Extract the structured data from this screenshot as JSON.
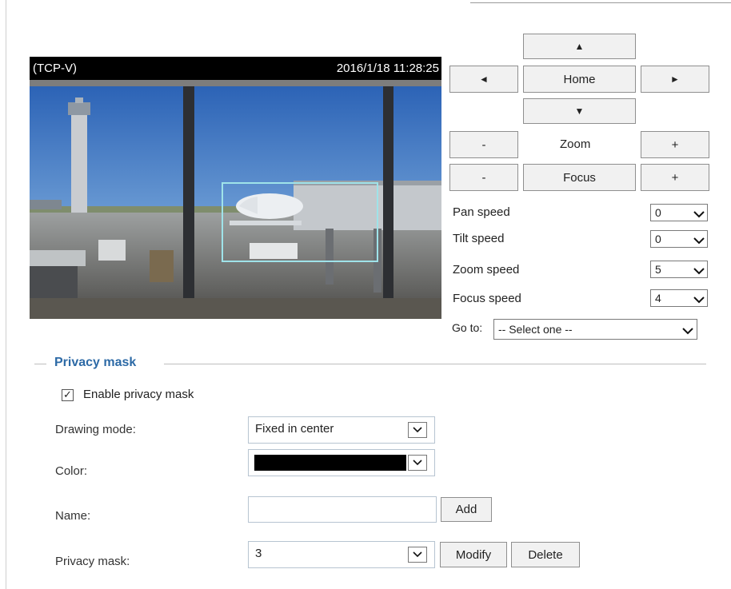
{
  "video": {
    "camera_label": "(TCP-V)",
    "timestamp": "2016/1/18 11:28:25"
  },
  "ptz": {
    "up_glyph": "▲",
    "down_glyph": "▼",
    "left_glyph": "◄",
    "right_glyph": "►",
    "home_label": "Home",
    "zoom_label": "Zoom",
    "focus_label": "Focus",
    "minus_label": "-",
    "plus_label": "+",
    "speeds": [
      {
        "label": "Pan speed",
        "value": "0"
      },
      {
        "label": "Tilt speed",
        "value": "0"
      },
      {
        "label": "Zoom speed",
        "value": "5"
      },
      {
        "label": "Focus speed",
        "value": "4"
      }
    ],
    "goto_label": "Go to:",
    "goto_value": "-- Select one --"
  },
  "privacy": {
    "section_title": "Privacy mask",
    "enable_label": "Enable privacy mask",
    "enable_checked": true,
    "drawing_mode_label": "Drawing mode:",
    "drawing_mode_value": "Fixed in center",
    "color_label": "Color:",
    "color_value": "#000000",
    "name_label": "Name:",
    "name_value": "",
    "add_label": "Add",
    "mask_label": "Privacy mask:",
    "mask_value": "3",
    "modify_label": "Modify",
    "delete_label": "Delete"
  },
  "icons": {
    "check": "✓",
    "chevron_down": "❯"
  }
}
